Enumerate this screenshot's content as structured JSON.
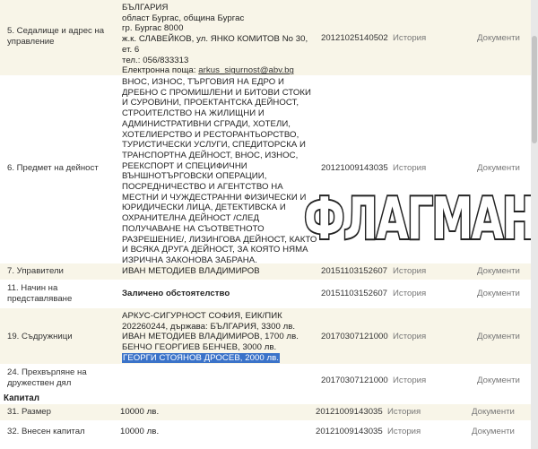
{
  "rows": [
    {
      "label": "5.  Седалище и адрес на управление",
      "value_lines": [
        "БЪЛГАРИЯ",
        "област Бургас, община Бургас",
        "гр. Бургас 8000",
        "ж.к. СЛАВЕЙКОВ, ул. ЯНКО КОМИТОВ No 30,",
        "ет. 6",
        "тел.: 056/833313"
      ],
      "email_prefix": "Електронна поща: ",
      "email": "arkus_sigurnost@abv.bg",
      "number": "20121025140502",
      "history": "История",
      "documents": "Документи"
    },
    {
      "label": "6.  Предмет на дейност",
      "value_lines": [
        "ВНОС, ИЗНОС, ТЪРГОВИЯ НА ЕДРО И",
        "ДРЕБНО С ПРОМИШЛЕНИ И БИТОВИ СТОКИ",
        "И СУРОВИНИ, ПРОЕКТАНТСКА ДЕЙНОСТ,",
        "СТРОИТЕЛСТВО НА ЖИЛИЩНИ И",
        "АДМИНИСТРАТИВНИ СГРАДИ, ХОТЕЛИ,",
        "ХОТЕЛИЕРСТВО И РЕСТОРАНТЬОРСТВО,",
        "ТУРИСТИЧЕСКИ УСЛУГИ, СПЕДИТОРСКА И",
        "ТРАНСПОРТНА ДЕЙНОСТ, ВНОС, ИЗНОС,",
        "РЕЕКСПОРТ И СПЕЦИФИЧНИ",
        "ВЪНШНОТЪРГОВСКИ ОПЕРАЦИИ,",
        "ПОСРЕДНИЧЕСТВО И АГЕНТСТВО НА",
        "МЕСТНИ И ЧУЖДЕСТРАННИ ФИЗИЧЕСКИ И",
        "ЮРИДИЧЕСКИ ЛИЦА, ДЕТЕКТИВСКА И",
        "ОХРАНИТЕЛНА ДЕЙНОСТ /СЛЕД",
        "ПОЛУЧАВАНЕ НА СЪОТВЕТНОТО",
        "РАЗРЕШЕНИЕ/, ЛИЗИНГОВА ДЕЙНОСТ, КАКТО",
        "И ВСЯКА ДРУГА ДЕЙНОСТ, ЗА КОЯТО НЯМА",
        "ИЗРИЧНА ЗАКОНОВА ЗАБРАНА."
      ],
      "number": "20121009143035",
      "history": "История",
      "documents": "Документи"
    },
    {
      "label": "7.  Управители",
      "value": "ИВАН МЕТОДИЕВ ВЛАДИМИРОВ",
      "number": "20151103152607",
      "history": "История",
      "documents": "Документи"
    },
    {
      "label": "11.  Начин на представляване",
      "value": "Заличено обстоятелство",
      "number": "20151103152607",
      "history": "История",
      "documents": "Документи"
    },
    {
      "label": "19.  Съдружници",
      "value_lines": [
        "АРКУС-СИГУРНОСТ СОФИЯ, ЕИК/ПИК",
        "202260244, държава: БЪЛГАРИЯ, 3300 лв.",
        "ИВАН МЕТОДИЕВ ВЛАДИМИРОВ, 1700 лв.",
        "БЕНЧО ГЕОРГИЕВ БЕНЧЕВ, 3000 лв."
      ],
      "highlighted": "ГЕОРГИ СТОЯНОВ ДРОСЕВ, 2000 лв.",
      "number": "20170307121000",
      "history": "История",
      "documents": "Документи"
    },
    {
      "label": "24.  Прехвърляне на дружествен дял",
      "number": "20170307121000",
      "history": "История",
      "documents": "Документи"
    }
  ],
  "capital_section": {
    "title": "Капитал",
    "rows": [
      {
        "label": "31.  Размер",
        "value": "10000 лв.",
        "number": "20121009143035",
        "history": "История",
        "documents": "Документи"
      },
      {
        "label": "32.  Внесен капитал",
        "value": "10000 лв.",
        "number": "20121009143035",
        "history": "История",
        "documents": "Документи"
      }
    ]
  },
  "watermark": {
    "text": "ФЛАГМАН",
    "color": "#ffffff",
    "outline": "#222222"
  }
}
